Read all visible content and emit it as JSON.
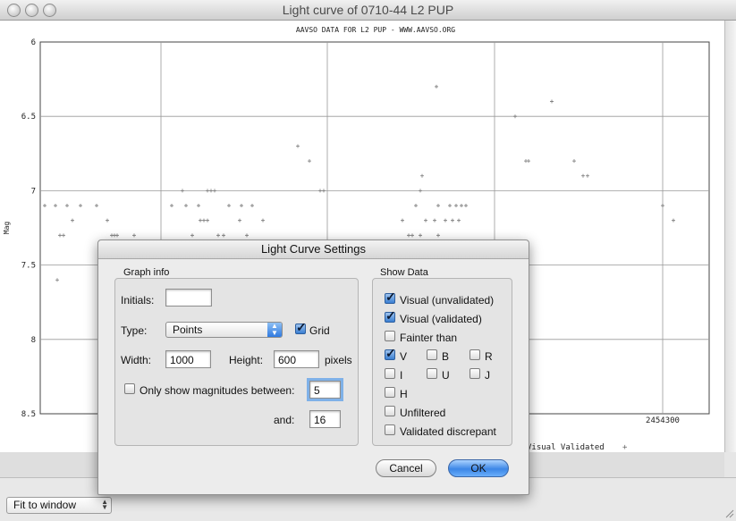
{
  "window": {
    "title": "Light curve of 0710-44  L2 PUP"
  },
  "chart_data": {
    "type": "scatter",
    "title": "AAVSO DATA FOR L2 PUP - WWW.AAVSO.ORG",
    "ylabel": "Mag",
    "xlabel": "",
    "ylim": [
      6,
      8.5
    ],
    "y_inverted": true,
    "yticks": [
      "6",
      "6.5",
      "7",
      "7.5",
      "8",
      "8.5"
    ],
    "xtick_label": "2454300",
    "grid": true,
    "legend": {
      "entry": "Visual Validated",
      "marker": "+"
    },
    "points": [
      [
        50,
        7.1
      ],
      [
        62,
        7.1
      ],
      [
        75,
        7.1
      ],
      [
        90,
        7.1
      ],
      [
        108,
        7.1
      ],
      [
        67,
        7.3
      ],
      [
        71,
        7.3
      ],
      [
        81,
        7.2
      ],
      [
        120,
        7.2
      ],
      [
        64,
        7.6
      ],
      [
        125,
        7.3
      ],
      [
        128,
        7.3
      ],
      [
        131,
        7.3
      ],
      [
        150,
        7.3
      ],
      [
        192,
        7.1
      ],
      [
        204,
        7.0
      ],
      [
        208,
        7.1
      ],
      [
        222,
        7.1
      ],
      [
        232,
        7.0
      ],
      [
        236,
        7.0
      ],
      [
        240,
        7.0
      ],
      [
        256,
        7.1
      ],
      [
        270,
        7.1
      ],
      [
        282,
        7.1
      ],
      [
        224,
        7.2
      ],
      [
        228,
        7.2
      ],
      [
        232,
        7.2
      ],
      [
        268,
        7.2
      ],
      [
        294,
        7.2
      ],
      [
        215,
        7.3
      ],
      [
        244,
        7.3
      ],
      [
        250,
        7.3
      ],
      [
        276,
        7.3
      ],
      [
        333,
        6.7
      ],
      [
        346,
        6.8
      ],
      [
        358,
        7.0
      ],
      [
        362,
        7.0
      ],
      [
        488,
        6.3
      ],
      [
        472,
        6.9
      ],
      [
        470,
        7.0
      ],
      [
        465,
        7.1
      ],
      [
        490,
        7.1
      ],
      [
        503,
        7.1
      ],
      [
        510,
        7.1
      ],
      [
        516,
        7.1
      ],
      [
        521,
        7.1
      ],
      [
        450,
        7.2
      ],
      [
        476,
        7.2
      ],
      [
        486,
        7.2
      ],
      [
        498,
        7.2
      ],
      [
        506,
        7.2
      ],
      [
        513,
        7.2
      ],
      [
        457,
        7.3
      ],
      [
        461,
        7.3
      ],
      [
        470,
        7.3
      ],
      [
        490,
        7.3
      ],
      [
        576,
        6.5
      ],
      [
        617,
        6.4
      ],
      [
        588,
        6.8
      ],
      [
        591,
        6.8
      ],
      [
        642,
        6.8
      ],
      [
        652,
        6.9
      ],
      [
        657,
        6.9
      ],
      [
        741,
        7.1
      ],
      [
        753,
        7.2
      ]
    ]
  },
  "dialog": {
    "title": "Light Curve Settings",
    "graph_info": {
      "label": "Graph info",
      "initials_label": "Initials:",
      "initials_value": "",
      "type_label": "Type:",
      "type_value": "Points",
      "grid_label": "Grid",
      "grid_checked": true,
      "width_label": "Width:",
      "width_value": "1000",
      "height_label": "Height:",
      "height_value": "600",
      "pixels_label": "pixels",
      "only_show_label": "Only show magnitudes between:",
      "only_show_checked": false,
      "min_value": "5",
      "and_label": "and:",
      "max_value": "16"
    },
    "show_data": {
      "label": "Show Data",
      "visual_unvalidated": "Visual (unvalidated)",
      "visual_validated": "Visual (validated)",
      "fainter_than": "Fainter than",
      "v": "V",
      "b": "B",
      "r": "R",
      "i": "I",
      "u": "U",
      "j": "J",
      "h": "H",
      "unfiltered": "Unfiltered",
      "validated_discrepant": "Validated discrepant"
    },
    "cancel_label": "Cancel",
    "ok_label": "OK"
  },
  "bottom": {
    "fit_label": "Fit to window"
  }
}
